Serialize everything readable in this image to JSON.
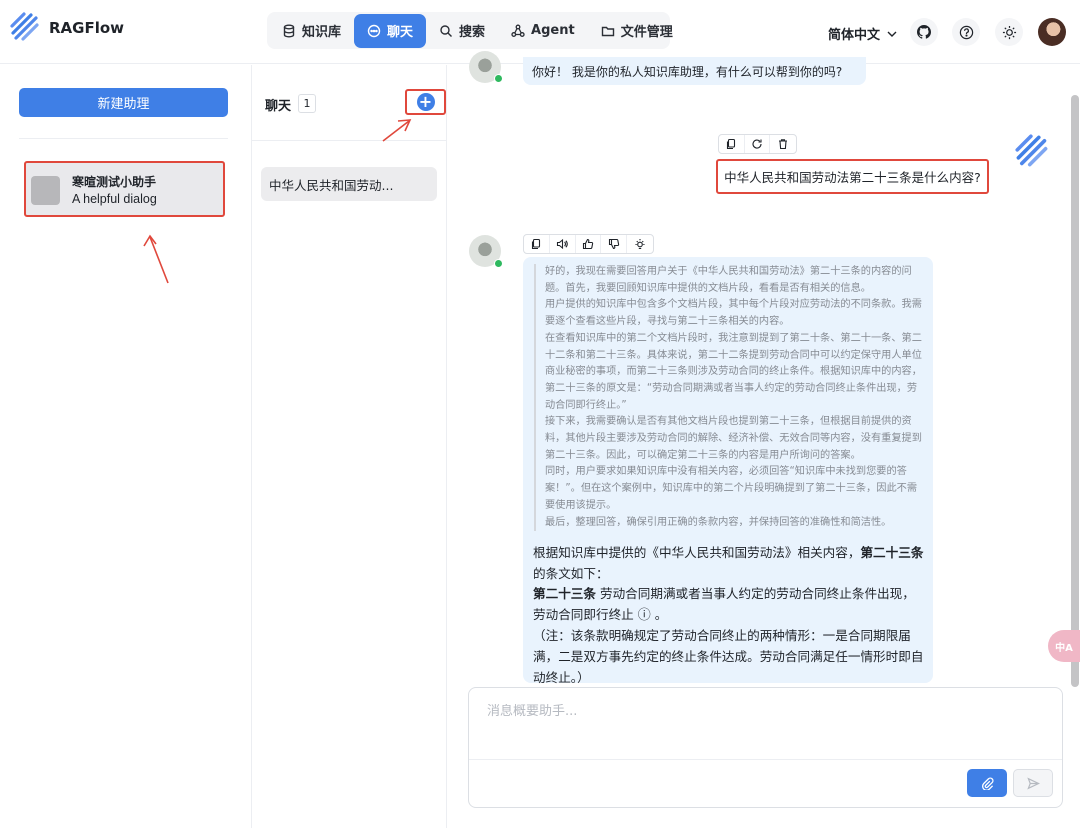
{
  "app": {
    "name": "RAGFlow"
  },
  "nav": {
    "items": [
      {
        "label": "知识库",
        "icon": "database-icon"
      },
      {
        "label": "聊天",
        "icon": "chat-icon",
        "active": true
      },
      {
        "label": "搜索",
        "icon": "search-icon"
      },
      {
        "label": "Agent",
        "icon": "agent-icon"
      },
      {
        "label": "文件管理",
        "icon": "folder-icon"
      }
    ]
  },
  "header": {
    "language": "简体中文",
    "icons": [
      "github-icon",
      "help-icon",
      "theme-icon"
    ]
  },
  "left": {
    "new_assistant": "新建助理",
    "assistant": {
      "name": "寒暄测试小助手",
      "description": "A helpful dialog"
    }
  },
  "middle": {
    "title": "聊天",
    "count": "1",
    "conversations": [
      "中华人民共和国劳动..."
    ]
  },
  "chat": {
    "greeting": "你好！ 我是你的私人知识库助理，有什么可以帮到你的吗?",
    "user_question": "中华人民共和国劳动法第二十三条是什么内容?",
    "thinking": [
      "好的，我现在需要回答用户关于《中华人民共和国劳动法》第二十三条的内容的问题。首先，我要回顾知识库中提供的文档片段，看看是否有相关的信息。",
      "用户提供的知识库中包含多个文档片段，其中每个片段对应劳动法的不同条款。我需要逐个查看这些片段，寻找与第二十三条相关的内容。",
      "在查看知识库中的第二个文档片段时，我注意到提到了第二十条、第二十一条、第二十二条和第二十三条。具体来说，第二十二条提到劳动合同中可以约定保守用人单位商业秘密的事项，而第二十三条则涉及劳动合同的终止条件。根据知识库中的内容，第二十三条的原文是：“劳动合同期满或者当事人约定的劳动合同终止条件出现，劳动合同即行终止。”",
      "接下来，我需要确认是否有其他文档片段也提到第二十三条，但根据目前提供的资料，其他片段主要涉及劳动合同的解除、经济补偿、无效合同等内容，没有重复提到第二十三条。因此，可以确定第二十三条的内容是用户所询问的答案。",
      "同时，用户要求如果知识库中没有相关内容，必须回答“知识库中未找到您要的答案！”。但在这个案例中，知识库中的第二个片段明确提到了第二十三条，因此不需要使用该提示。",
      "最后，整理回答，确保引用正确的条款内容，并保持回答的准确性和简洁性。"
    ],
    "answer_intro_a": "根据知识库中提供的《中华人民共和国劳动法》相关内容，",
    "answer_intro_b": "第二十三条",
    "answer_intro_c": "的条文如下：",
    "answer_article_label": "第二十三条",
    "answer_article_text": " 劳动合同期满或者当事人约定的劳动合同终止条件出现，劳动合同即行终止 ",
    "answer_ref": "ⓘ",
    "answer_end": " 。",
    "answer_note": "（注：该条款明确规定了劳动合同终止的两种情形：一是合同期限届满，二是双方事先约定的终止条件达成。劳动合同满足任一情形时即自动终止。）"
  },
  "input": {
    "placeholder": "消息概要助手..."
  },
  "translate_badge": "中A",
  "colors": {
    "accent": "#3f7fe6",
    "highlight": "#e0483c",
    "bubble": "#e9f3fd"
  }
}
